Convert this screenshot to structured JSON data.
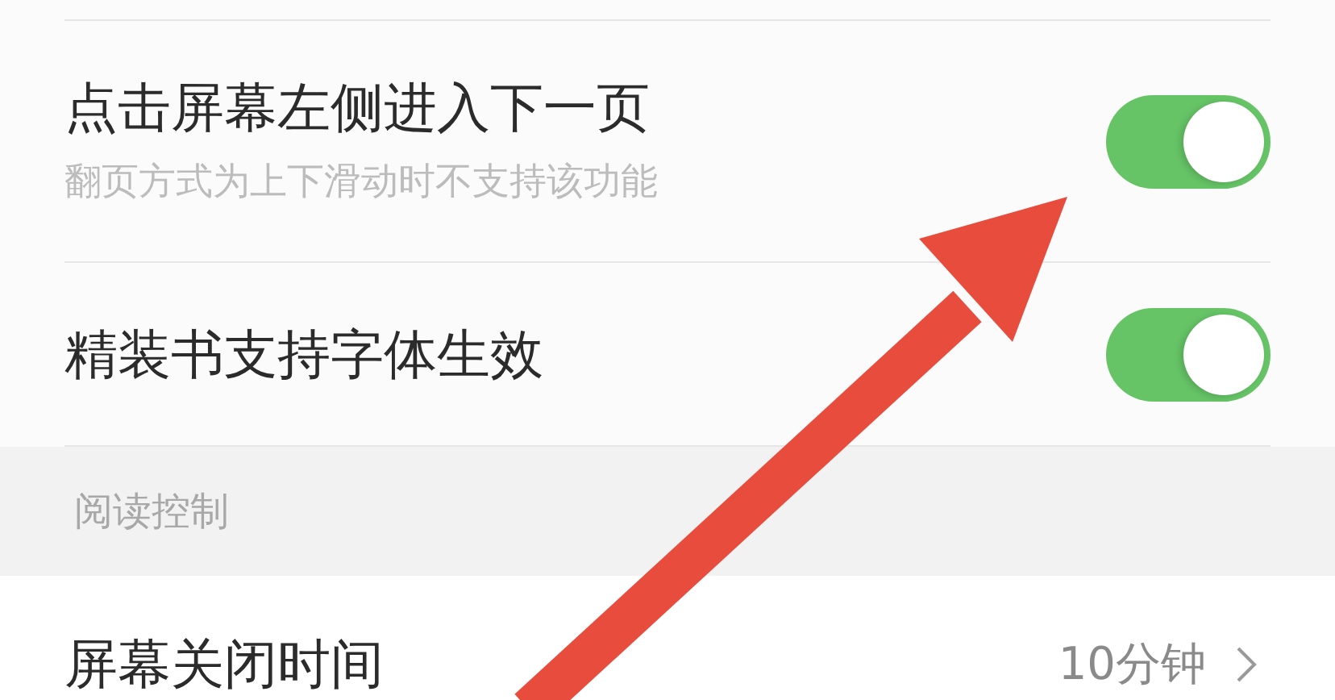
{
  "settings": [
    {
      "kind": "toggle",
      "title": "点击屏幕左侧进入下一页",
      "subtitle": "翻页方式为上下滑动时不支持该功能",
      "on": true
    },
    {
      "kind": "toggle",
      "title": "精装书支持字体生效",
      "on": true
    },
    {
      "kind": "section",
      "title": "阅读控制"
    },
    {
      "kind": "value",
      "title": "屏幕关闭时间",
      "value": "10分钟"
    }
  ]
}
